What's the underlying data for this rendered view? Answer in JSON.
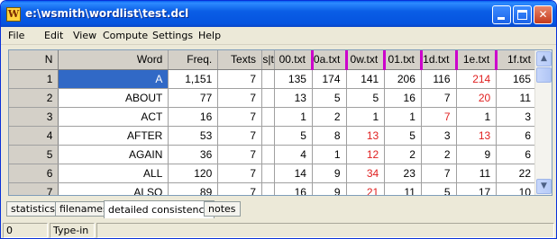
{
  "window": {
    "title": "e:\\wsmith\\wordlist\\test.dcl",
    "app_icon_letter": "W"
  },
  "menu": {
    "items": [
      "File",
      "Edit",
      "View",
      "Compute",
      "Settings",
      "Help"
    ]
  },
  "grid": {
    "columns": [
      "N",
      "Word",
      "Freq.",
      "Texts",
      "s|t",
      "00.txt",
      "0a.txt",
      "0w.txt",
      "01.txt",
      "1d.txt",
      "1e.txt",
      "1f.txt"
    ],
    "rows": [
      {
        "n": "1",
        "word": "A",
        "freq": "1,151",
        "texts": "7",
        "c1": "135",
        "c2": "174",
        "c3": "141",
        "c4": "206",
        "c5": "116",
        "c6": "214",
        "c7": "165",
        "red": [
          6
        ]
      },
      {
        "n": "2",
        "word": "ABOUT",
        "freq": "77",
        "texts": "7",
        "c1": "13",
        "c2": "5",
        "c3": "5",
        "c4": "16",
        "c5": "7",
        "c6": "20",
        "c7": "11",
        "red": [
          6
        ]
      },
      {
        "n": "3",
        "word": "ACT",
        "freq": "16",
        "texts": "7",
        "c1": "1",
        "c2": "2",
        "c3": "1",
        "c4": "1",
        "c5": "7",
        "c6": "1",
        "c7": "3",
        "red": [
          5
        ]
      },
      {
        "n": "4",
        "word": "AFTER",
        "freq": "53",
        "texts": "7",
        "c1": "5",
        "c2": "8",
        "c3": "13",
        "c4": "5",
        "c5": "3",
        "c6": "13",
        "c7": "6",
        "red": [
          3,
          6
        ]
      },
      {
        "n": "5",
        "word": "AGAIN",
        "freq": "36",
        "texts": "7",
        "c1": "4",
        "c2": "1",
        "c3": "12",
        "c4": "2",
        "c5": "2",
        "c6": "9",
        "c7": "6",
        "red": [
          3
        ]
      },
      {
        "n": "6",
        "word": "ALL",
        "freq": "120",
        "texts": "7",
        "c1": "14",
        "c2": "9",
        "c3": "34",
        "c4": "23",
        "c5": "7",
        "c6": "11",
        "c7": "22",
        "red": [
          3
        ]
      },
      {
        "n": "7",
        "word": "ALSO",
        "freq": "89",
        "texts": "7",
        "c1": "16",
        "c2": "9",
        "c3": "21",
        "c4": "11",
        "c5": "5",
        "c6": "17",
        "c7": "10",
        "red": [
          3
        ]
      }
    ]
  },
  "tabs": [
    "statistics",
    "filenames",
    "detailed consistency",
    "notes"
  ],
  "status": {
    "pane1": "0",
    "pane2": "Type-in"
  },
  "colors": {
    "highlight_red": "#e02020",
    "selection_blue": "#3169c6"
  }
}
